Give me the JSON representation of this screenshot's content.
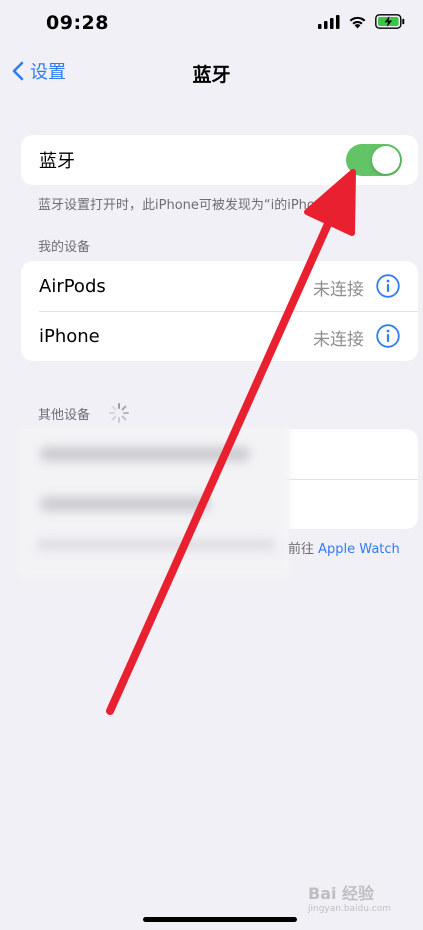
{
  "status": {
    "time": "09:28"
  },
  "nav": {
    "back_label": "设置",
    "title": "蓝牙"
  },
  "bluetooth": {
    "label": "蓝牙",
    "enabled": true,
    "note": "蓝牙设置打开时，此iPhone可被发现为“i的iPhone”。"
  },
  "my_devices": {
    "header": "我的设备",
    "items": [
      {
        "name": "AirPods",
        "status": "未连接"
      },
      {
        "name": "iPhone",
        "status": "未连接"
      }
    ]
  },
  "other_devices": {
    "header": "其他设备"
  },
  "watch_note": {
    "prefix": "前往",
    "link": "Apple Watch"
  },
  "watermark": {
    "text": "Bai 经验",
    "sub": "jingyan.baidu.com"
  },
  "colors": {
    "accent": "#2f7cf6",
    "toggle_on": "#62c466",
    "arrow": "#e8202f"
  }
}
